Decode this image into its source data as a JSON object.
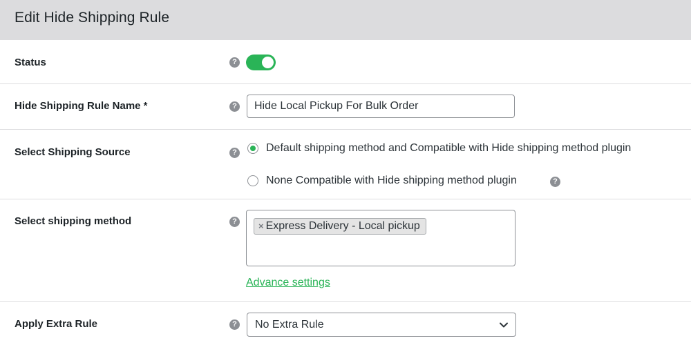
{
  "header": {
    "title": "Edit Hide Shipping Rule"
  },
  "fields": {
    "status": {
      "label": "Status",
      "help_glyph": "?",
      "enabled": true
    },
    "rule_name": {
      "label": "Hide Shipping Rule Name *",
      "help_glyph": "?",
      "value": "Hide Local Pickup For Bulk Order"
    },
    "shipping_source": {
      "label": "Select Shipping Source",
      "help_glyph": "?",
      "options": [
        {
          "label": "Default shipping method and Compatible with Hide shipping method plugin",
          "selected": true
        },
        {
          "label": "None Compatible with Hide shipping method plugin",
          "selected": false,
          "help_glyph": "?"
        }
      ]
    },
    "shipping_method": {
      "label": "Select shipping method",
      "help_glyph": "?",
      "selected_items": [
        {
          "remove_glyph": "×",
          "label": "Express Delivery - Local pickup"
        }
      ],
      "advance_link": "Advance settings"
    },
    "extra_rule": {
      "label": "Apply Extra Rule",
      "help_glyph": "?",
      "selected": "No Extra Rule"
    }
  },
  "colors": {
    "accent": "#2ab457",
    "header_bg": "#dcdcde",
    "border": "#8c8f94",
    "help_icon": "#8c8f94"
  },
  "icons": {
    "help": "question-circle-icon",
    "remove": "close-icon",
    "dropdown": "chevron-down-icon"
  }
}
